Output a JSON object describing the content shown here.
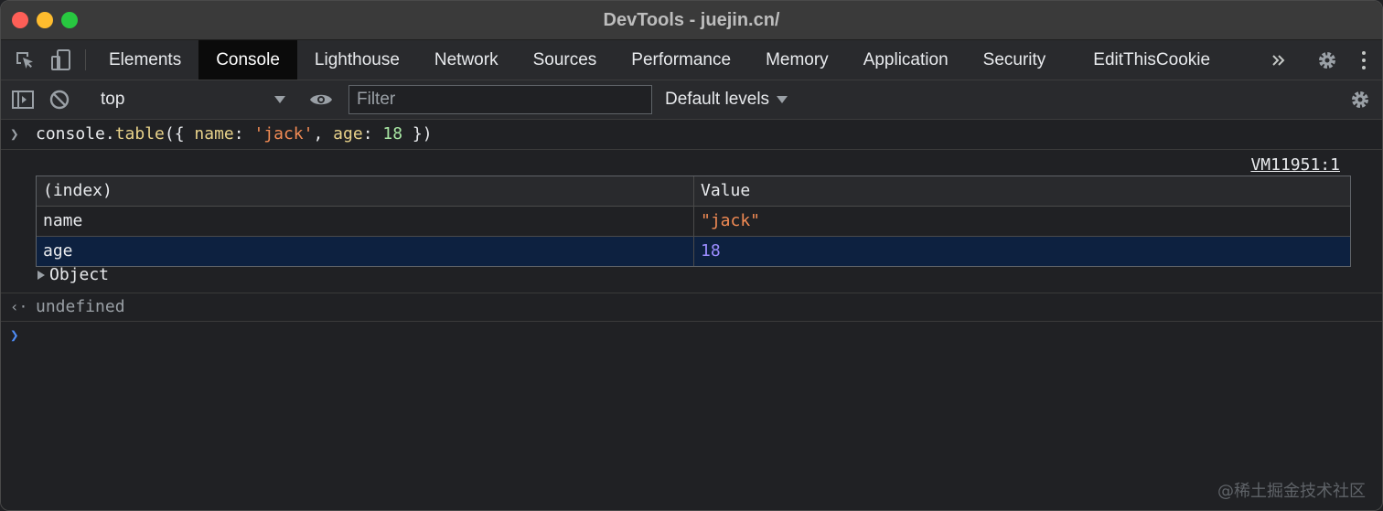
{
  "window": {
    "title": "DevTools - juejin.cn/"
  },
  "tabs": [
    {
      "label": "Elements"
    },
    {
      "label": "Console"
    },
    {
      "label": "Lighthouse"
    },
    {
      "label": "Network"
    },
    {
      "label": "Sources"
    },
    {
      "label": "Performance"
    },
    {
      "label": "Memory"
    },
    {
      "label": "Application"
    },
    {
      "label": "Security"
    },
    {
      "label": "EditThisCookie"
    }
  ],
  "active_tab": "Console",
  "toolbar": {
    "context": "top",
    "filter_placeholder": "Filter",
    "levels": "Default levels"
  },
  "console": {
    "input": {
      "t1": "console.",
      "t2": "table",
      "t3": "({ ",
      "t4": "name",
      "t5": ": ",
      "t6": "'jack'",
      "t7": ", ",
      "t8": "age",
      "t9": ": ",
      "t10": "18",
      "t11": " })"
    },
    "source_link": "VM11951:1",
    "table": {
      "headers": [
        "(index)",
        "Value"
      ],
      "rows": [
        {
          "index": "name",
          "value": "\"jack\""
        },
        {
          "index": "age",
          "value": "18"
        }
      ]
    },
    "object_label": "Object",
    "result": "undefined"
  },
  "watermark": "@稀土掘金技术社区",
  "colors": {
    "background": "#202124",
    "active_tab": "#0b0b0b",
    "selected_row": "#0d2140",
    "string": "#f28b54",
    "number": "#9b8cff",
    "prompt_blue": "#4e8cf5"
  },
  "icons": [
    "inspect-element-icon",
    "device-toolbar-icon",
    "more-tabs-icon",
    "settings-icon",
    "kebab-menu-icon",
    "sidebar-toggle-icon",
    "clear-console-icon",
    "eye-icon"
  ]
}
